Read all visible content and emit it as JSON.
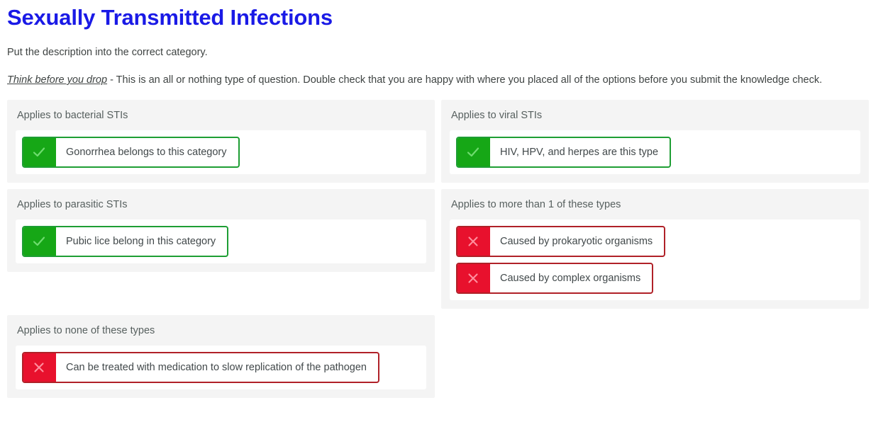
{
  "header": {
    "title": "Sexually Transmitted Infections",
    "instruction": "Put the description into the correct category.",
    "warning_emphasis": "Think before you drop",
    "warning_rest": " - This is an all or nothing type of question. Double check that you are happy with where you placed all of the options before you submit the knowledge check."
  },
  "colors": {
    "title": "#1a1ae6",
    "correct_badge": "#16a716",
    "correct_border": "#1e9e34",
    "incorrect_badge": "#e8112d",
    "incorrect_border": "#b02128",
    "card_background": "#f4f4f4",
    "dropzone_background": "#ffffff"
  },
  "categories": [
    {
      "title": "Applies to bacterial STIs",
      "column": "left",
      "items": [
        {
          "label": "Gonorrhea belongs to this category",
          "status": "correct",
          "icon": "check-icon"
        }
      ]
    },
    {
      "title": "Applies to viral STIs",
      "column": "right",
      "items": [
        {
          "label": "HIV, HPV, and herpes are this type",
          "status": "correct",
          "icon": "check-icon"
        }
      ]
    },
    {
      "title": "Applies to parasitic STIs",
      "column": "left",
      "items": [
        {
          "label": "Pubic lice belong in this category",
          "status": "correct",
          "icon": "check-icon"
        }
      ]
    },
    {
      "title": "Applies to more than 1 of these types",
      "column": "right",
      "items": [
        {
          "label": "Caused by prokaryotic organisms",
          "status": "incorrect",
          "icon": "cross-icon"
        },
        {
          "label": "Caused by complex organisms",
          "status": "incorrect",
          "icon": "cross-icon"
        }
      ]
    },
    {
      "title": "Applies to none of these types",
      "column": "left",
      "items": [
        {
          "label": "Can be treated with medication to slow replication of the pathogen",
          "status": "incorrect",
          "icon": "cross-icon"
        }
      ]
    }
  ]
}
